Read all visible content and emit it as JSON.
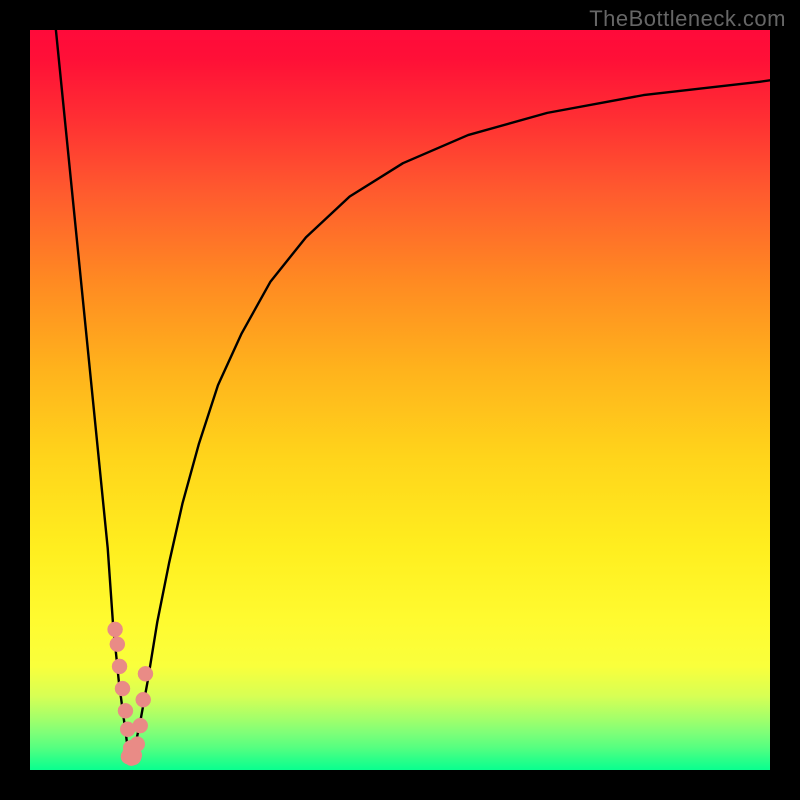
{
  "watermark": "TheBottleneck.com",
  "colors": {
    "frame_bg": "#000000",
    "curve": "#000000",
    "dot": "#e98b86",
    "gradient_top": "#ff0a3a",
    "gradient_bottom": "#09ff8f"
  },
  "chart_data": {
    "type": "line",
    "title": "",
    "xlabel": "",
    "ylabel": "",
    "xlim": [
      0,
      100
    ],
    "ylim": [
      0,
      100
    ],
    "grid": false,
    "legend": false,
    "series": [
      {
        "name": "left-branch",
        "x": [
          3.5,
          4.5,
          5.5,
          6.5,
          7.5,
          8.5,
          9.5,
          10.5,
          11.2,
          12.0,
          12.8,
          13.4
        ],
        "y": [
          100,
          90,
          80,
          70,
          60,
          50,
          40,
          30,
          20,
          12,
          6,
          1.5
        ]
      },
      {
        "name": "right-branch",
        "x": [
          13.8,
          14.8,
          15.9,
          17.2,
          18.8,
          20.6,
          22.8,
          25.4,
          28.6,
          32.5,
          37.3,
          43.2,
          50.4,
          59.2,
          69.9,
          82.9,
          98.6,
          100
        ],
        "y": [
          1.5,
          6,
          12,
          20,
          28,
          36,
          44,
          52,
          59,
          66,
          72,
          77.5,
          82,
          85.8,
          88.8,
          91.2,
          93,
          93.2
        ]
      }
    ],
    "scatter_points": {
      "name": "markers",
      "x": [
        11.5,
        11.8,
        12.1,
        12.5,
        12.9,
        13.2,
        13.6,
        13.3,
        13.7,
        14.1,
        14.5,
        14.9,
        15.3,
        15.6,
        13.5,
        14.0
      ],
      "y": [
        19,
        17,
        14,
        11,
        8,
        5.5,
        3,
        1.8,
        1.6,
        2.0,
        3.5,
        6.0,
        9.5,
        13,
        2.2,
        1.7
      ]
    }
  }
}
